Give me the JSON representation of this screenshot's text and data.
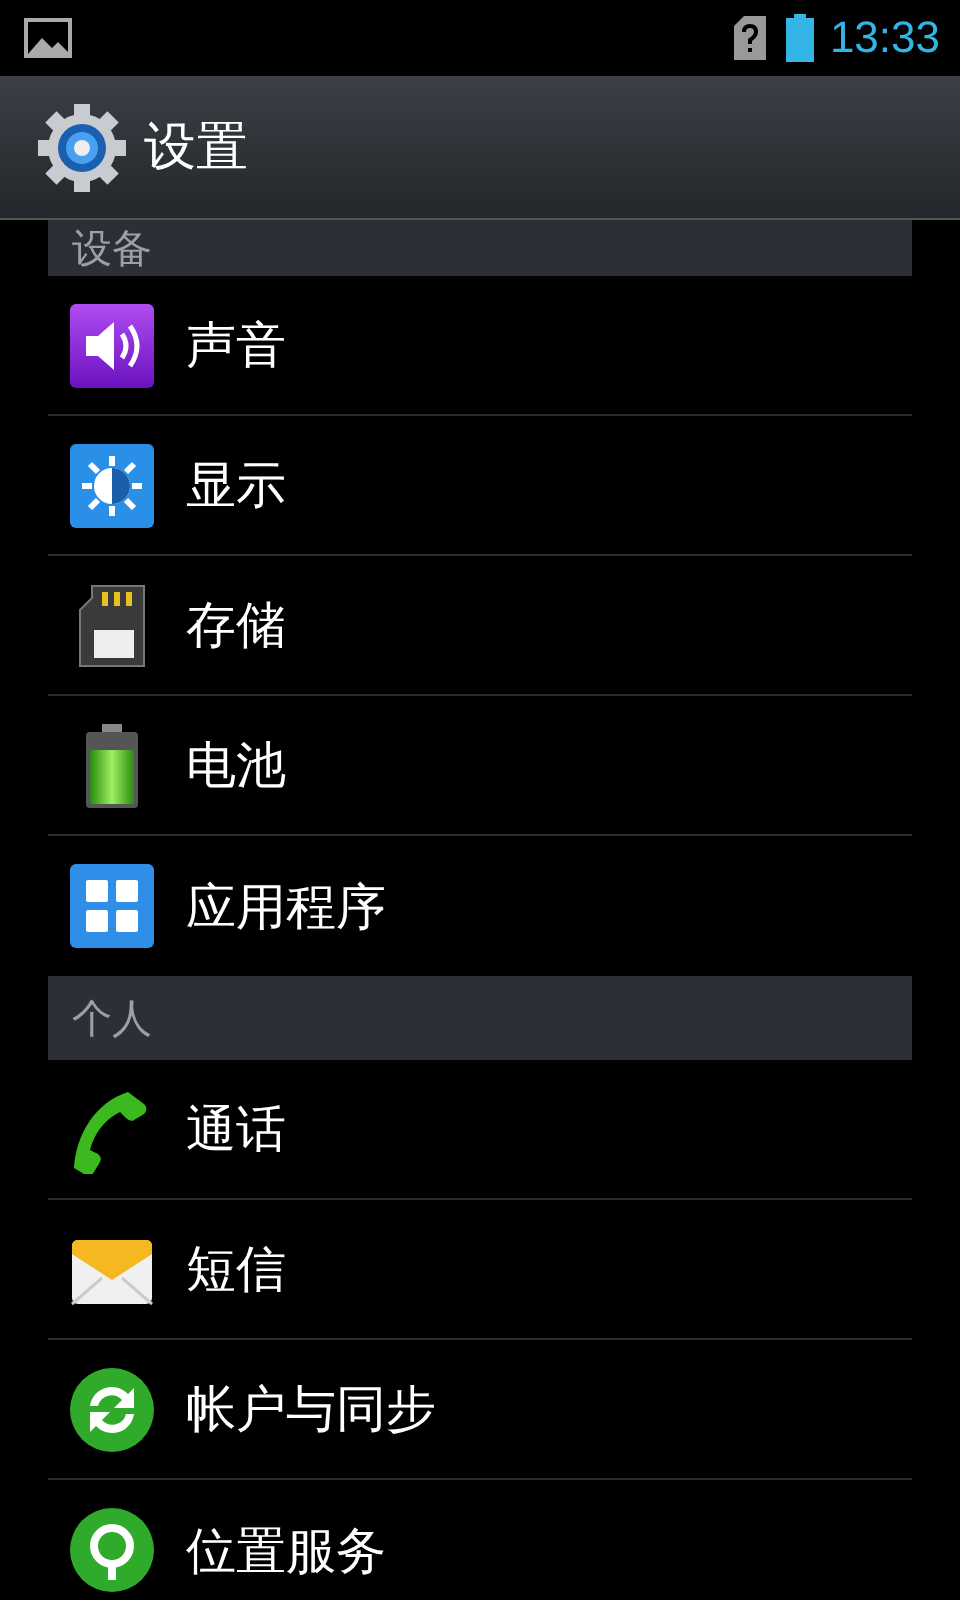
{
  "status_bar": {
    "time": "13:33"
  },
  "action_bar": {
    "title": "设置"
  },
  "sections": [
    {
      "header": "设备",
      "items": [
        {
          "label": "声音",
          "kind": "sound"
        },
        {
          "label": "显示",
          "kind": "display"
        },
        {
          "label": "存储",
          "kind": "storage"
        },
        {
          "label": "电池",
          "kind": "battery"
        },
        {
          "label": "应用程序",
          "kind": "apps"
        }
      ]
    },
    {
      "header": "个人",
      "items": [
        {
          "label": "通话",
          "kind": "phone"
        },
        {
          "label": "短信",
          "kind": "sms"
        },
        {
          "label": "帐户与同步",
          "kind": "sync"
        },
        {
          "label": "位置服务",
          "kind": "location"
        }
      ]
    }
  ]
}
